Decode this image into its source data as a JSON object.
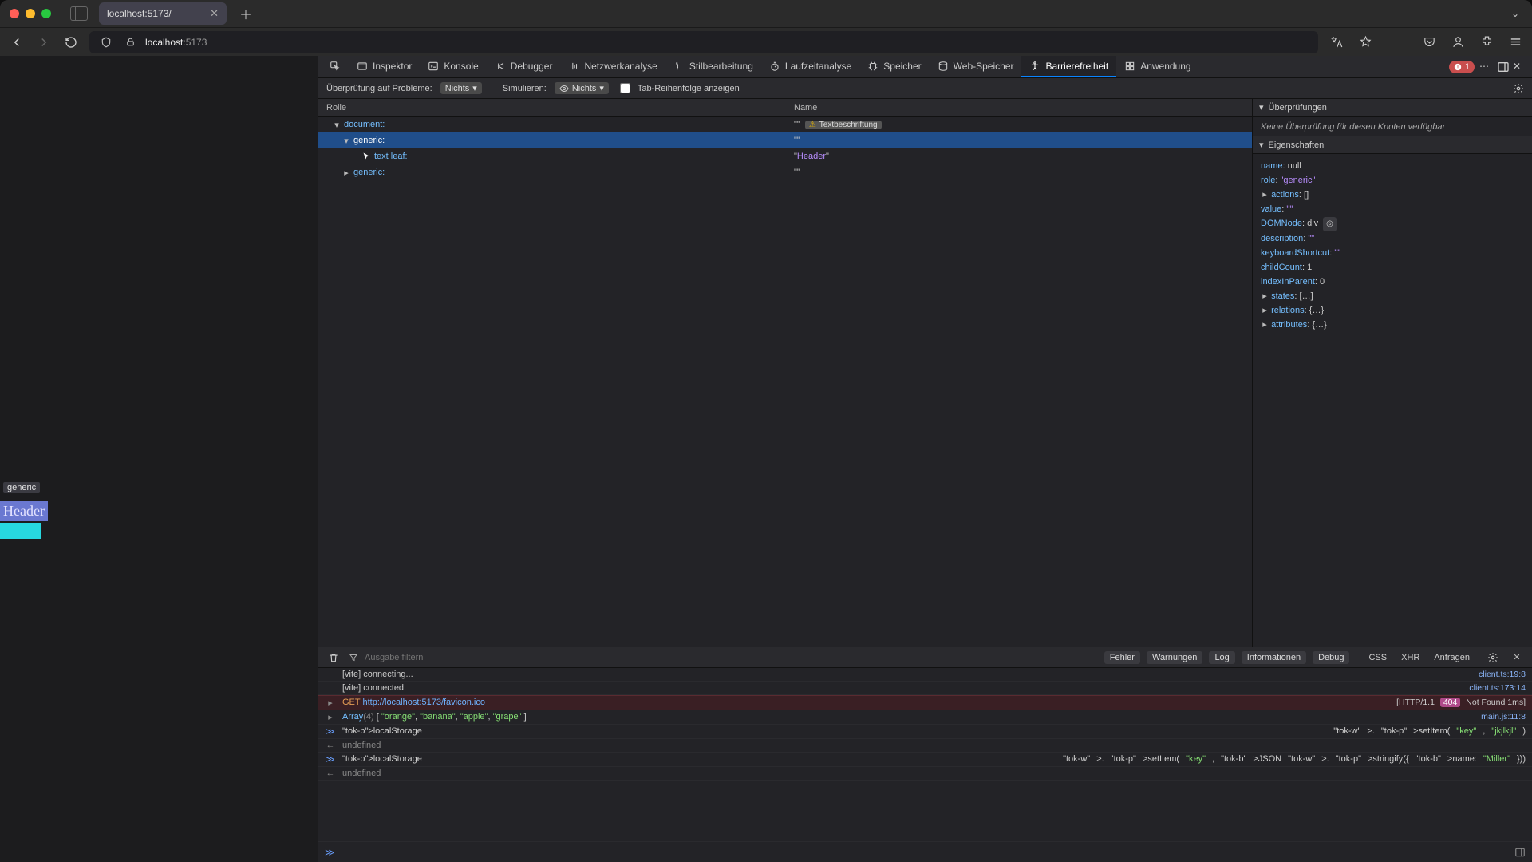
{
  "browser": {
    "tab_title": "localhost:5173/",
    "url_host": "localhost",
    "url_port": ":5173"
  },
  "page_overlay": {
    "role_label": "generic",
    "header_text": "Header"
  },
  "devtools_tabs": {
    "inspector": "Inspektor",
    "console": "Konsole",
    "debugger": "Debugger",
    "network": "Netzwerkanalyse",
    "style": "Stilbearbeitung",
    "perf": "Laufzeitanalyse",
    "memory": "Speicher",
    "storage": "Web-Speicher",
    "a11y": "Barrierefreiheit",
    "app": "Anwendung",
    "error_count": "1"
  },
  "a11y_toolbar": {
    "check_label": "Überprüfung auf Probleme:",
    "check_value": "Nichts",
    "sim_label": "Simulieren:",
    "sim_value": "Nichts",
    "taborder_label": "Tab-Reihenfolge anzeigen"
  },
  "tree": {
    "col_role": "Rolle",
    "col_name": "Name",
    "rows": [
      {
        "indent": 1,
        "tw": "▾",
        "role": "document:",
        "name": "\"\"",
        "badge": "Textbeschriftung",
        "sel": false
      },
      {
        "indent": 2,
        "tw": "▾",
        "role": "generic:",
        "name": "\"\"",
        "sel": true
      },
      {
        "indent": 3,
        "tw": "",
        "role": "text leaf:",
        "name": "\"Header\"",
        "sel": false,
        "cursor": true
      },
      {
        "indent": 2,
        "tw": "▸",
        "role": "generic:",
        "name": "\"\"",
        "sel": false
      }
    ]
  },
  "checks": {
    "title": "Überprüfungen",
    "empty": "Keine Überprüfung für diesen Knoten verfügbar"
  },
  "props": {
    "title": "Eigenschaften",
    "items": [
      {
        "k": "name",
        "v": "null",
        "t": "plain"
      },
      {
        "k": "role",
        "v": "\"generic\"",
        "t": "str"
      },
      {
        "k": "actions",
        "v": "[]",
        "t": "plain",
        "tw": "▸"
      },
      {
        "k": "value",
        "v": "\"\"",
        "t": "str"
      },
      {
        "k": "DOMNode",
        "v": "div",
        "t": "node"
      },
      {
        "k": "description",
        "v": "\"\"",
        "t": "str"
      },
      {
        "k": "keyboardShortcut",
        "v": "\"\"",
        "t": "str"
      },
      {
        "k": "childCount",
        "v": "1",
        "t": "plain"
      },
      {
        "k": "indexInParent",
        "v": "0",
        "t": "plain"
      },
      {
        "k": "states",
        "v": "[…]",
        "t": "plain",
        "tw": "▸"
      },
      {
        "k": "relations",
        "v": "{…}",
        "t": "plain",
        "tw": "▸"
      },
      {
        "k": "attributes",
        "v": "{…}",
        "t": "plain",
        "tw": "▸"
      }
    ]
  },
  "console": {
    "filter_placeholder": "Ausgabe filtern",
    "filters": {
      "errors": "Fehler",
      "warnings": "Warnungen",
      "log": "Log",
      "info": "Informationen",
      "debug": "Debug",
      "css": "CSS",
      "xhr": "XHR",
      "requests": "Anfragen"
    },
    "lines": [
      {
        "type": "log",
        "msg": "[vite] connecting...",
        "src": "client.ts:19:8"
      },
      {
        "type": "log",
        "msg": "[vite] connected.",
        "src": "client.ts:173:14"
      },
      {
        "type": "err",
        "gut": "▸",
        "msg_pre": "GET ",
        "url": "http://localhost:5173/favicon.ico",
        "right_pre": "[HTTP/1.1 ",
        "code": "404",
        "right_post": " Not Found 1ms]"
      },
      {
        "type": "array",
        "gut": "▸",
        "lead": "Array",
        "len": "(4)",
        "open": " [ ",
        "items": [
          "\"orange\"",
          "\"banana\"",
          "\"apple\"",
          "\"grape\""
        ],
        "close": " ]",
        "src": "main.js:11:8"
      },
      {
        "type": "in",
        "code": "localStorage.setItem(\"key\", \"jkjlkjl\")"
      },
      {
        "type": "out",
        "msg": "undefined"
      },
      {
        "type": "in",
        "code": "localStorage.setItem(\"key\", JSON.stringify({ name: \"Miller\"}))"
      },
      {
        "type": "out",
        "msg": "undefined"
      }
    ]
  }
}
